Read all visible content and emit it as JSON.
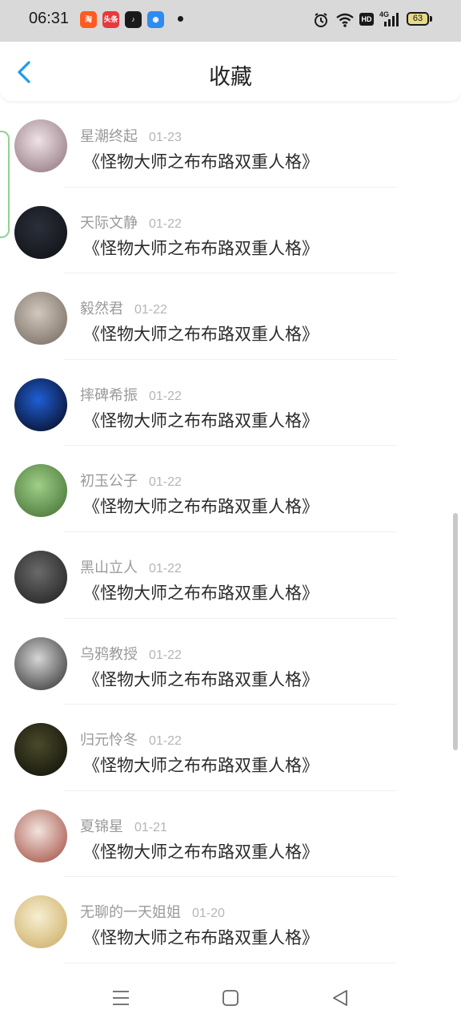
{
  "status_bar": {
    "time": "06:31",
    "app_icons": [
      {
        "name": "taobao-app-icon",
        "color": "#ff5a1f",
        "glyph": "淘"
      },
      {
        "name": "toutiao-app-icon",
        "color": "#e8383d",
        "glyph": "头条"
      },
      {
        "name": "douyin-app-icon",
        "color": "#1a1a1a",
        "glyph": "♪"
      },
      {
        "name": "browser-app-icon",
        "color": "#2e8bf0",
        "glyph": "◉"
      }
    ],
    "network_badge": "HD",
    "network_type": "4G",
    "battery": "63"
  },
  "header": {
    "title": "收藏"
  },
  "colors": {
    "accent": "#1e9be8",
    "status_bg": "#d9d9d9"
  },
  "items": [
    {
      "user": "星潮终起",
      "date": "01-23",
      "title": "《怪物大师之布布路双重人格》",
      "avatar_colors": [
        "#efe2e6",
        "#8a6f7a"
      ]
    },
    {
      "user": "天际文静",
      "date": "01-22",
      "title": "《怪物大师之布布路双重人格》",
      "avatar_colors": [
        "#2b2f3a",
        "#0e0f14"
      ]
    },
    {
      "user": "毅然君",
      "date": "01-22",
      "title": "《怪物大师之布布路双重人格》",
      "avatar_colors": [
        "#d3c8bd",
        "#6f655c"
      ]
    },
    {
      "user": "摔碑希振",
      "date": "01-22",
      "title": "《怪物大师之布布路双重人格》",
      "avatar_colors": [
        "#1f5fd6",
        "#050512"
      ]
    },
    {
      "user": "初玉公子",
      "date": "01-22",
      "title": "《怪物大师之布布路双重人格》",
      "avatar_colors": [
        "#9fcf88",
        "#3f6b2f"
      ]
    },
    {
      "user": "黑山立人",
      "date": "01-22",
      "title": "《怪物大师之布布路双重人格》",
      "avatar_colors": [
        "#6a6a6a",
        "#1c1c1c"
      ]
    },
    {
      "user": "乌鸦教授",
      "date": "01-22",
      "title": "《怪物大师之布布路双重人格》",
      "avatar_colors": [
        "#d6d6d6",
        "#2a2a2a"
      ]
    },
    {
      "user": "归元怜冬",
      "date": "01-22",
      "title": "《怪物大师之布布路双重人格》",
      "avatar_colors": [
        "#4a4a2a",
        "#0d0d08"
      ]
    },
    {
      "user": "夏锦星",
      "date": "01-21",
      "title": "《怪物大师之布布路双重人格》",
      "avatar_colors": [
        "#f1e4de",
        "#a0473b"
      ]
    },
    {
      "user": "无聊的一天姐姐",
      "date": "01-20",
      "title": "《怪物大师之布布路双重人格》",
      "avatar_colors": [
        "#f7efd2",
        "#c9a95c"
      ]
    }
  ],
  "nav": {
    "menu_icon": "menu-icon",
    "home_icon": "home-icon",
    "back_icon": "back-triangle-icon"
  }
}
